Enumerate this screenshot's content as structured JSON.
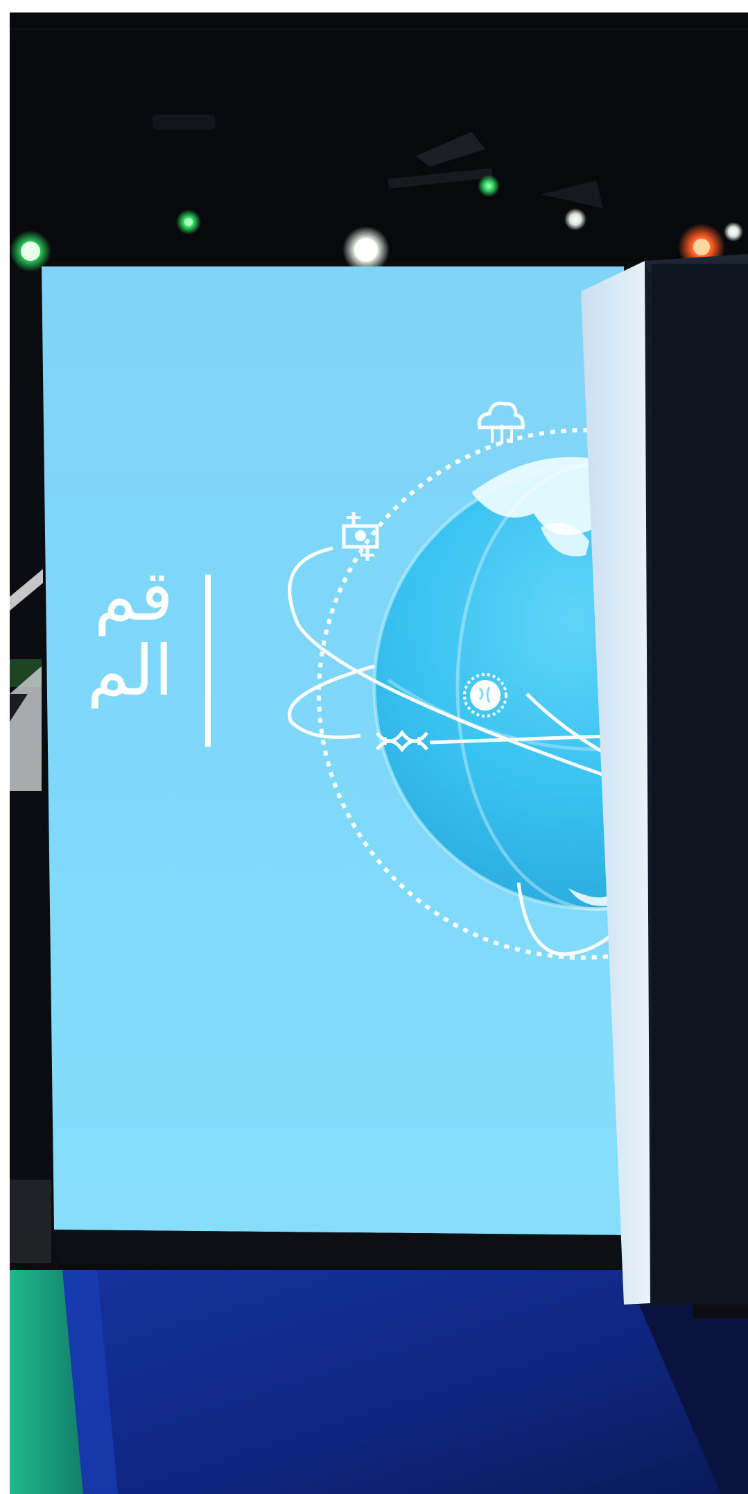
{
  "scene": {
    "description_colors": {
      "screen": "#7dd8f8",
      "screen_light": "#86dcfb",
      "ceiling": "#0b0d10",
      "floor": "#0b1c5c",
      "green_light": "#2ad15c",
      "warm_light": "#ff6a2a",
      "panel": "#0f1722",
      "panel_edge": "#dbe9f2"
    }
  },
  "screen_text": {
    "line1": "قم",
    "line2": "الم"
  }
}
